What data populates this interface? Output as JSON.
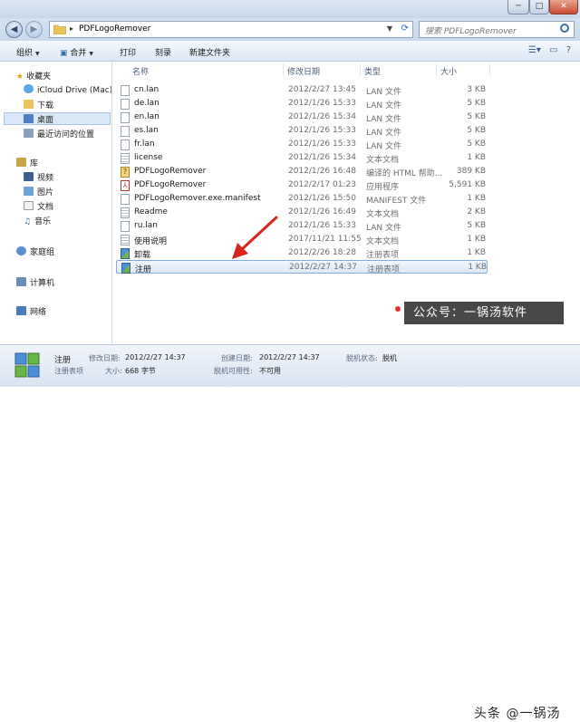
{
  "window": {
    "min": "─",
    "max": "□",
    "close": "✕"
  },
  "address": {
    "crumb": "PDFLogoRemover",
    "search_placeholder": "搜索 PDFLogoRemover"
  },
  "toolbar": {
    "organize": "组织",
    "share": "合并",
    "print": "打印",
    "burn": "刻录",
    "newfolder": "新建文件夹"
  },
  "sidebar": {
    "favorites": "收藏夹",
    "icloud": "iCloud Drive (Mac)",
    "downloads": "下载",
    "desktop": "桌面",
    "recent": "最近访问的位置",
    "libraries": "库",
    "videos": "视频",
    "pictures": "图片",
    "documents": "文档",
    "music": "音乐",
    "homegroup": "家庭组",
    "computer": "计算机",
    "network": "网络"
  },
  "columns": {
    "name": "名称",
    "date": "修改日期",
    "type": "类型",
    "size": "大小"
  },
  "files": [
    {
      "name": "cn.lan",
      "date": "2012/2/27 13:45",
      "type": "LAN 文件",
      "size": "3 KB",
      "icon": "file-icon"
    },
    {
      "name": "de.lan",
      "date": "2012/1/26 15:33",
      "type": "LAN 文件",
      "size": "5 KB",
      "icon": "file-icon"
    },
    {
      "name": "en.lan",
      "date": "2012/1/26 15:34",
      "type": "LAN 文件",
      "size": "5 KB",
      "icon": "file-icon"
    },
    {
      "name": "es.lan",
      "date": "2012/1/26 15:33",
      "type": "LAN 文件",
      "size": "5 KB",
      "icon": "file-icon"
    },
    {
      "name": "fr.lan",
      "date": "2012/1/26 15:33",
      "type": "LAN 文件",
      "size": "5 KB",
      "icon": "file-icon"
    },
    {
      "name": "license",
      "date": "2012/1/26 15:34",
      "type": "文本文档",
      "size": "1 KB",
      "icon": "text-file-icon"
    },
    {
      "name": "PDFLogoRemover",
      "date": "2012/1/26 16:48",
      "type": "编译的 HTML 帮助...",
      "size": "389 KB",
      "icon": "help-file-icon"
    },
    {
      "name": "PDFLogoRemover",
      "date": "2012/2/17 01:23",
      "type": "应用程序",
      "size": "5,591 KB",
      "icon": "pdf-app-icon"
    },
    {
      "name": "PDFLogoRemover.exe.manifest",
      "date": "2012/1/26 15:50",
      "type": "MANIFEST 文件",
      "size": "1 KB",
      "icon": "file-icon"
    },
    {
      "name": "Readme",
      "date": "2012/1/26 16:49",
      "type": "文本文档",
      "size": "2 KB",
      "icon": "text-file-icon"
    },
    {
      "name": "ru.lan",
      "date": "2012/1/26 15:33",
      "type": "LAN 文件",
      "size": "5 KB",
      "icon": "file-icon"
    },
    {
      "name": "使用说明",
      "date": "2017/11/21 11:55",
      "type": "文本文档",
      "size": "1 KB",
      "icon": "text-file-icon"
    },
    {
      "name": "卸载",
      "date": "2012/2/26 18:28",
      "type": "注册表项",
      "size": "1 KB",
      "icon": "registry-icon"
    },
    {
      "name": "注册",
      "date": "2012/2/27 14:37",
      "type": "注册表项",
      "size": "1 KB",
      "icon": "registry-icon"
    }
  ],
  "details": {
    "name": "注册",
    "kind": "注册表项",
    "modified_label": "修改日期:",
    "modified": "2012/2/27 14:37",
    "size_label": "大小:",
    "size": "668 字节",
    "created_label": "创建日期:",
    "created": "2012/2/27 14:37",
    "avail_label": "脱机可用性:",
    "avail": "不可用",
    "offline_label": "脱机状态:",
    "offline": "脱机"
  },
  "overlay": {
    "caption": "公众号：一锅汤软件",
    "watermark": "头条 @一锅汤"
  },
  "colors": {
    "accent": "#3d6eac",
    "selection": "#dbe9f8",
    "arrow": "#d9251d"
  }
}
